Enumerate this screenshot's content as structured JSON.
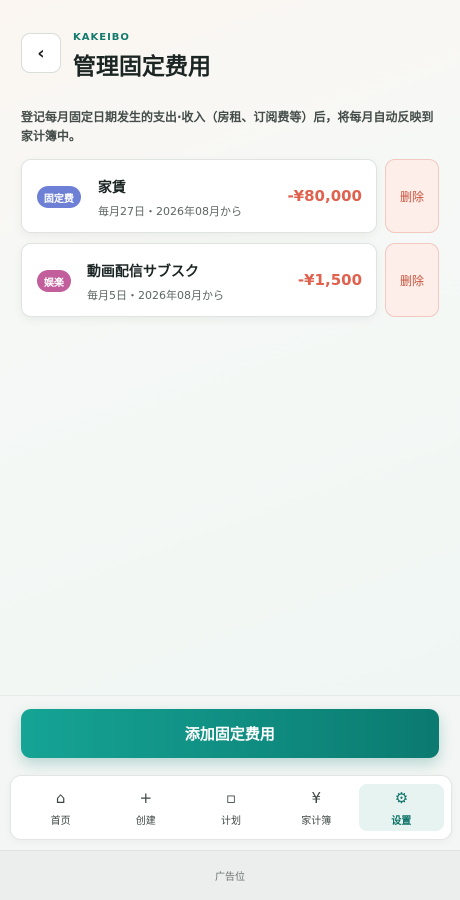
{
  "header": {
    "back_icon": "chevron-left",
    "brand": "KAKEIBO",
    "title": "管理固定费用"
  },
  "description": "登记每月固定日期发生的支出·收入（房租、订阅费等）后，将每月自动反映到家计簿中。",
  "fixed_items": [
    {
      "badge": "固定费",
      "badge_color": "#6e7fd6",
      "name": "家賃",
      "schedule": "毎月27日・2026年08月から",
      "amount": "-¥80,000",
      "delete_label": "删除"
    },
    {
      "badge": "娱楽",
      "badge_color": "#c25e9b",
      "name": "動画配信サブスク",
      "schedule": "毎月5日・2026年08月から",
      "amount": "-¥1,500",
      "delete_label": "删除"
    }
  ],
  "add_button": "添加固定费用",
  "tabs": [
    {
      "icon": "⌂",
      "icon_name": "home-icon",
      "label": "首页"
    },
    {
      "icon": "+",
      "icon_name": "plus-icon",
      "label": "创建"
    },
    {
      "icon": "▫",
      "icon_name": "plan-icon",
      "label": "计划"
    },
    {
      "icon": "¥",
      "icon_name": "yen-icon",
      "label": "家计簿"
    },
    {
      "icon": "⚙",
      "icon_name": "gear-icon",
      "label": "设置",
      "active": true
    }
  ],
  "ad_label": "广告位"
}
